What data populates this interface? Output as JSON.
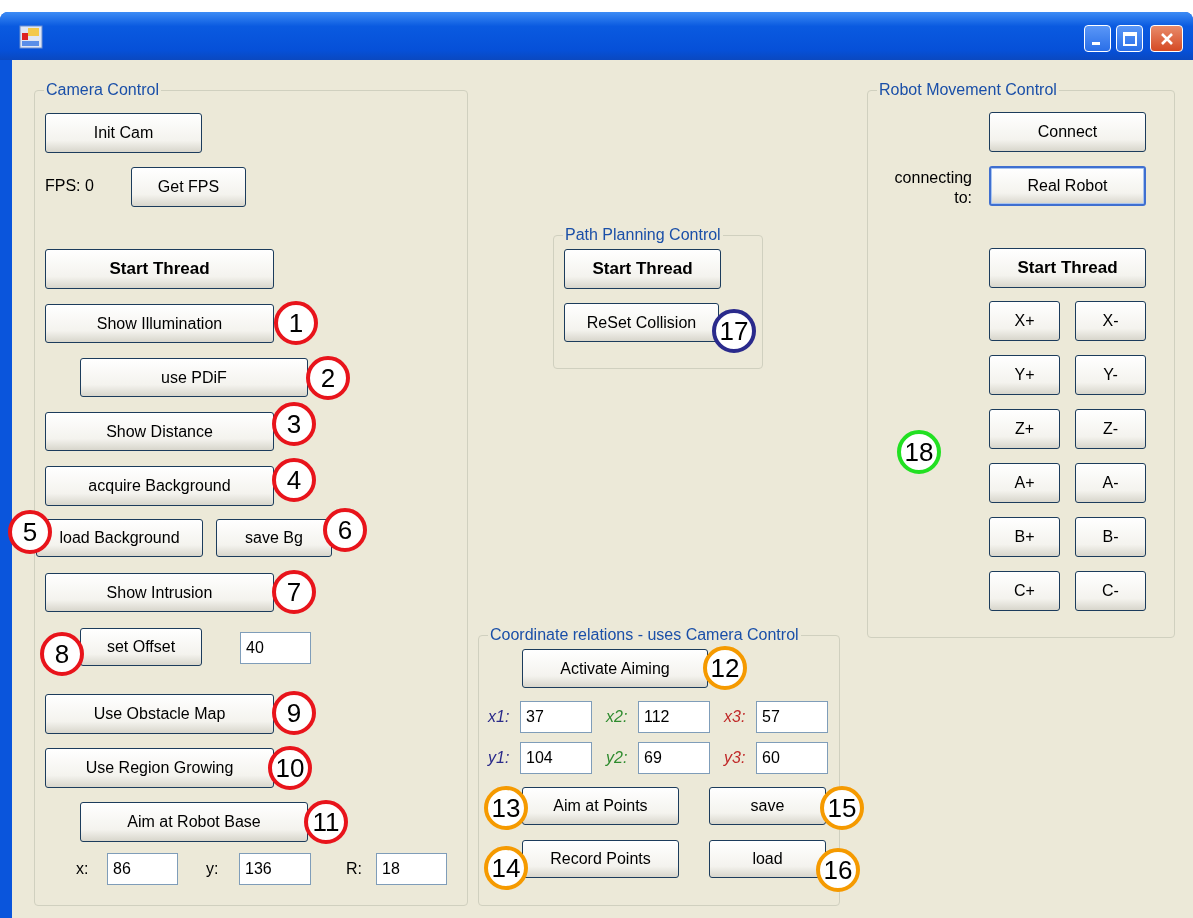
{
  "camera_control": {
    "title": "Camera Control",
    "controls": [
      {
        "kind": "button",
        "label": "Init Cam",
        "bold": false
      },
      {
        "kind": "label",
        "text": "FPS:"
      },
      {
        "kind": "label",
        "text": "0"
      },
      {
        "kind": "button",
        "label": "Get FPS",
        "bold": false
      },
      {
        "kind": "button",
        "label": "Start Thread",
        "bold": true
      },
      {
        "kind": "button",
        "label": "Show Illumination",
        "bold": false
      },
      {
        "kind": "button",
        "label": "use PDiF",
        "bold": false
      },
      {
        "kind": "button",
        "label": "Show Distance",
        "bold": false
      },
      {
        "kind": "button",
        "label": "acquire Background",
        "bold": false
      },
      {
        "kind": "button",
        "label": "load Background",
        "bold": false
      },
      {
        "kind": "button",
        "label": "save Bg",
        "bold": false
      },
      {
        "kind": "button",
        "label": "Show Intrusion",
        "bold": false
      },
      {
        "kind": "button",
        "label": "set Offset",
        "bold": false
      },
      {
        "kind": "field",
        "value": "40"
      },
      {
        "kind": "button",
        "label": "Use Obstacle Map",
        "bold": false
      },
      {
        "kind": "button",
        "label": "Use Region Growing",
        "bold": false
      },
      {
        "kind": "button",
        "label": "Aim at Robot Base",
        "bold": false
      },
      {
        "kind": "label",
        "text": "x:"
      },
      {
        "kind": "field",
        "value": "86"
      },
      {
        "kind": "label",
        "text": "y:"
      },
      {
        "kind": "field",
        "value": "136"
      },
      {
        "kind": "label",
        "text": "R:"
      },
      {
        "kind": "field",
        "value": "18"
      }
    ]
  },
  "path_planning_control": {
    "title": "Path Planning Control",
    "controls": [
      {
        "kind": "button",
        "label": "Start Thread",
        "bold": true
      },
      {
        "kind": "button",
        "label": "ReSet Collision",
        "bold": false
      }
    ]
  },
  "coordinate_relations": {
    "title": "Coordinate relations - uses Camera Control",
    "controls": [
      {
        "kind": "button",
        "label": "Activate Aiming",
        "bold": false
      },
      {
        "kind": "coord",
        "label": "x1:",
        "value": "37",
        "color": "#2a2a8a"
      },
      {
        "kind": "coord",
        "label": "x2:",
        "value": "112",
        "color": "#2e8b2e"
      },
      {
        "kind": "coord",
        "label": "x3:",
        "value": "57",
        "color": "#c02828"
      },
      {
        "kind": "coord",
        "label": "y1:",
        "value": "104",
        "color": "#2a2a8a"
      },
      {
        "kind": "coord",
        "label": "y2:",
        "value": "69",
        "color": "#2e8b2e"
      },
      {
        "kind": "coord",
        "label": "y3:",
        "value": "60",
        "color": "#c02828"
      },
      {
        "kind": "button",
        "label": "Aim at Points",
        "bold": false
      },
      {
        "kind": "button",
        "label": "save",
        "bold": false
      },
      {
        "kind": "button",
        "label": "Record Points",
        "bold": false
      },
      {
        "kind": "button",
        "label": "load",
        "bold": false
      }
    ]
  },
  "robot_movement_control": {
    "title": "Robot Movement Control",
    "controls": [
      {
        "kind": "button",
        "label": "Connect",
        "bold": false,
        "default": false
      },
      {
        "kind": "label",
        "text": "connecting to:"
      },
      {
        "kind": "button",
        "label": "Real Robot",
        "bold": false,
        "default": true
      },
      {
        "kind": "button",
        "label": "Start Thread",
        "bold": true,
        "default": false
      },
      {
        "kind": "button",
        "label": "X+",
        "bold": false,
        "default": false
      },
      {
        "kind": "button",
        "label": "X-",
        "bold": false,
        "default": false
      },
      {
        "kind": "button",
        "label": "Y+",
        "bold": false,
        "default": false
      },
      {
        "kind": "button",
        "label": "Y-",
        "bold": false,
        "default": false
      },
      {
        "kind": "button",
        "label": "Z+",
        "bold": false,
        "default": false
      },
      {
        "kind": "button",
        "label": "Z-",
        "bold": false,
        "default": false
      },
      {
        "kind": "button",
        "label": "A+",
        "bold": false,
        "default": false
      },
      {
        "kind": "button",
        "label": "A-",
        "bold": false,
        "default": false
      },
      {
        "kind": "button",
        "label": "B+",
        "bold": false,
        "default": false
      },
      {
        "kind": "button",
        "label": "B-",
        "bold": false,
        "default": false
      },
      {
        "kind": "button",
        "label": "C+",
        "bold": false,
        "default": false
      },
      {
        "kind": "button",
        "label": "C-",
        "bold": false,
        "default": false
      }
    ]
  },
  "annotations": [
    {
      "number": "1",
      "color": "#e8141b"
    },
    {
      "number": "2",
      "color": "#e8141b"
    },
    {
      "number": "3",
      "color": "#e8141b"
    },
    {
      "number": "4",
      "color": "#e8141b"
    },
    {
      "number": "5",
      "color": "#e8141b"
    },
    {
      "number": "6",
      "color": "#e8141b"
    },
    {
      "number": "7",
      "color": "#e8141b"
    },
    {
      "number": "8",
      "color": "#e8141b"
    },
    {
      "number": "9",
      "color": "#e8141b"
    },
    {
      "number": "10",
      "color": "#e8141b"
    },
    {
      "number": "11",
      "color": "#e8141b"
    },
    {
      "number": "12",
      "color": "#f59a00"
    },
    {
      "number": "13",
      "color": "#f59a00"
    },
    {
      "number": "14",
      "color": "#f59a00"
    },
    {
      "number": "15",
      "color": "#f59a00"
    },
    {
      "number": "16",
      "color": "#f59a00"
    },
    {
      "number": "17",
      "color": "#2a2a8c"
    },
    {
      "number": "18",
      "color": "#22e022"
    }
  ]
}
